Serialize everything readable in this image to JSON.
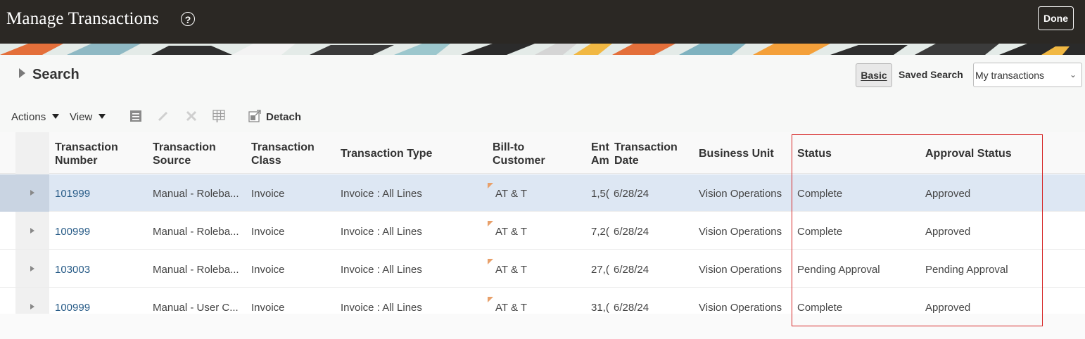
{
  "header": {
    "title": "Manage Transactions",
    "help_glyph": "?",
    "done_label": "Done"
  },
  "search": {
    "heading": "Search",
    "basic_label": "Basic",
    "saved_search_label": "Saved Search",
    "saved_search_value": "My transactions"
  },
  "toolbar": {
    "actions_label": "Actions",
    "view_label": "View",
    "detach_label": "Detach"
  },
  "table": {
    "columns": {
      "number": [
        "Transaction",
        "Number"
      ],
      "source": [
        "Transaction",
        "Source"
      ],
      "class": [
        "Transaction",
        "Class"
      ],
      "type": [
        "Transaction Type"
      ],
      "bill_to": [
        "Bill-to",
        "Customer"
      ],
      "amount": [
        "Ent",
        "Am"
      ],
      "date": [
        "Transaction",
        "Date"
      ],
      "business_unit": [
        "Business Unit"
      ],
      "status": [
        "Status"
      ],
      "approval_status": [
        "Approval Status"
      ]
    },
    "rows": [
      {
        "number": "101999",
        "source": "Manual - Roleba...",
        "class": "Invoice",
        "type": "Invoice : All Lines",
        "bill_to": "AT & T",
        "amount": "1,5(",
        "date": "6/28/24",
        "business_unit": "Vision Operations",
        "status": "Complete",
        "approval_status": "Approved"
      },
      {
        "number": "100999",
        "source": "Manual - Roleba...",
        "class": "Invoice",
        "type": "Invoice : All Lines",
        "bill_to": "AT & T",
        "amount": "7,2(",
        "date": "6/28/24",
        "business_unit": "Vision Operations",
        "status": "Complete",
        "approval_status": "Approved"
      },
      {
        "number": "103003",
        "source": "Manual - Roleba...",
        "class": "Invoice",
        "type": "Invoice : All Lines",
        "bill_to": "AT & T",
        "amount": "27,(",
        "date": "6/28/24",
        "business_unit": "Vision Operations",
        "status": "Pending Approval",
        "approval_status": "Pending Approval"
      },
      {
        "number": "100999",
        "source": "Manual - User C...",
        "class": "Invoice",
        "type": "Invoice : All Lines",
        "bill_to": "AT & T",
        "amount": "31,(",
        "date": "6/28/24",
        "business_unit": "Vision Operations",
        "status": "Complete",
        "approval_status": "Approved"
      }
    ]
  },
  "icons": {
    "toolbar": [
      "form-icon",
      "edit-icon",
      "delete-icon",
      "freeze-columns-icon",
      "detach-icon"
    ],
    "row": "expand-row-icon"
  },
  "colors": {
    "header_bg": "#2b2824",
    "link": "#275b87",
    "selected_row": "#dde7f3",
    "highlight": "#d62525"
  }
}
